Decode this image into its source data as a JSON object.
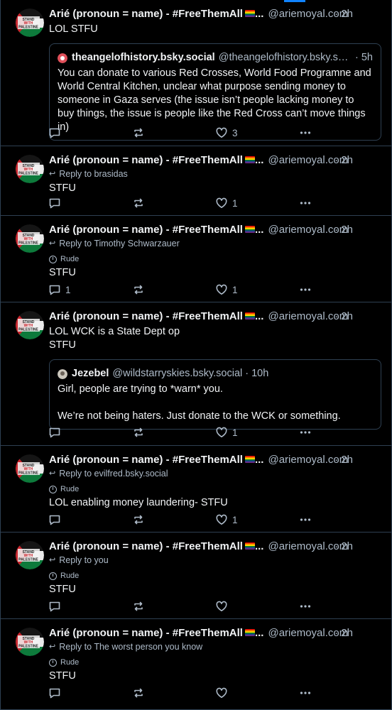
{
  "colors": {
    "background": "#000000",
    "border": "#2e4052",
    "muted": "#aebbc9",
    "accent": "#1083fe"
  },
  "author": {
    "name": "Arié (pronoun = name) - #FreeThemAll",
    "ellipsis": "...",
    "handle": "@ariemoyal.com",
    "avatar_text": "STAND WITH PALESTINE"
  },
  "posts": [
    {
      "time": "· 2h",
      "text": "LOL STFU",
      "quote": {
        "name": "theangelofhistory.bsky.social",
        "handle": "@theangelofhistory.bsky.soc...",
        "time": "· 5h",
        "text": "You can donate to various Red Crosses, World Food Programne and World Central Kitchen, unclear what purpose sending money to someone in Gaza serves (the issue isn’t people lacking money to buy things, the issue is people like the Red Cross can’t move things in)"
      },
      "reply_count": "",
      "like_count": "3"
    },
    {
      "time": "· 2h",
      "reply_to": "Reply to brasidas",
      "text": "STFU",
      "reply_count": "",
      "like_count": "1"
    },
    {
      "time": "· 2h",
      "reply_to": "Reply to Timothy Schwarzauer",
      "label": "Rude",
      "text": "STFU",
      "reply_count": "1",
      "like_count": "1"
    },
    {
      "time": "· 2h",
      "text": "LOL WCK is a State Dept op\nSTFU",
      "quote": {
        "name": "Jezebel",
        "handle": "@wildstarryskies.bsky.social",
        "time": "· 10h",
        "text": "Girl, people are trying to *warn* you.\n\nWe’re not being haters. Just donate to the WCK or something."
      },
      "reply_count": "",
      "like_count": "1"
    },
    {
      "time": "· 2h",
      "reply_to": "Reply to evilfred.bsky.social",
      "label": "Rude",
      "text": "LOL enabling money laundering- STFU",
      "reply_count": "",
      "like_count": "1"
    },
    {
      "time": "· 2h",
      "reply_to": "Reply to you",
      "label": "Rude",
      "text": "STFU",
      "reply_count": "",
      "like_count": ""
    },
    {
      "time": "· 2h",
      "reply_to": "Reply to The worst person you know",
      "label": "Rude",
      "text": "STFU",
      "reply_count": "",
      "like_count": ""
    }
  ],
  "icons": {
    "reply": "reply-bubble-icon",
    "repost": "repost-icon",
    "like": "heart-icon",
    "more": "more-dots-icon",
    "reply_to": "reply-arrow-icon",
    "label": "info-circle-icon"
  }
}
